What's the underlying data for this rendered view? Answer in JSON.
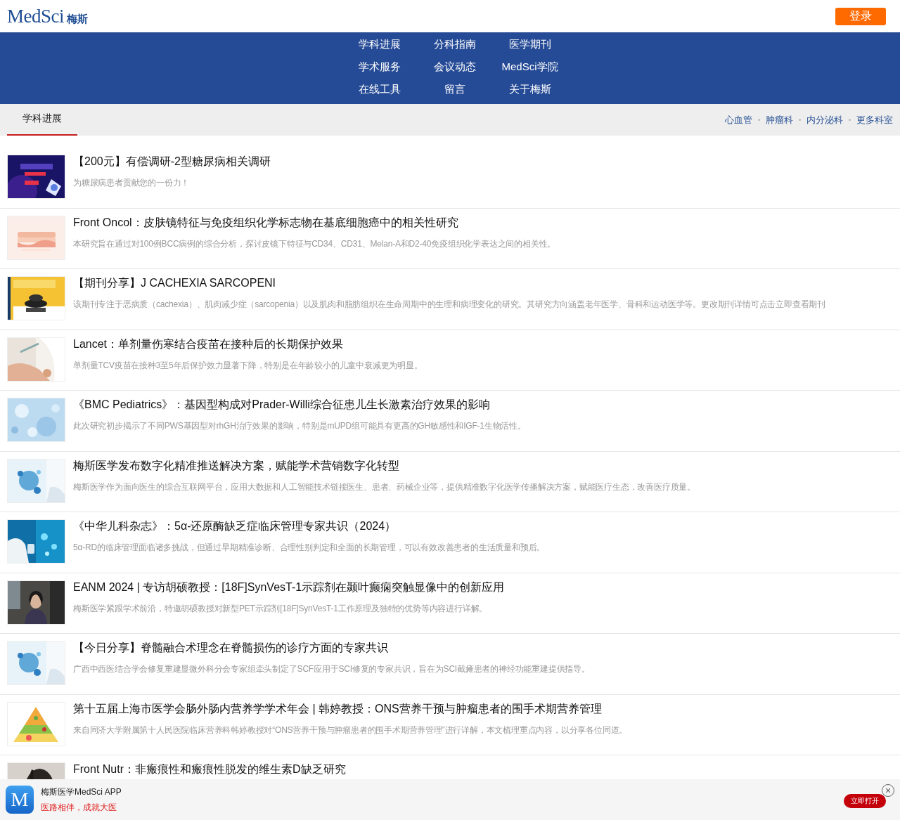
{
  "header": {
    "logo": "MedSci",
    "logo_suffix": "梅斯",
    "login_button": "登录"
  },
  "nav": {
    "items": [
      "学科进展",
      "分科指南",
      "医学期刊",
      "学术服务",
      "会议动态",
      "MedSci学院",
      "在线工具",
      "留言",
      "关于梅斯"
    ]
  },
  "tabs": [
    {
      "label": "学科进展",
      "selected": true
    }
  ],
  "departments": [
    "心血管",
    "肿瘤科",
    "内分泌科",
    "更多科室"
  ],
  "articles": [
    {
      "title": "【200元】有偿调研-2型糖尿病相关调研",
      "summary": "为糖尿病患者贡献您的一份力！"
    },
    {
      "title": "Front Oncol：皮肤镜特征与免疫组织化学标志物在基底细胞癌中的相关性研究",
      "summary": "本研究旨在通过对100例BCC病例的综合分析，探讨皮镜下特征与CD34、CD31、Melan-A和D2-40免疫组织化学表达之间的相关性。"
    },
    {
      "title": "【期刊分享】J CACHEXIA SARCOPENI",
      "summary": "该期刊专注于恶病质（cachexia）、肌肉减少症（sarcopenia）以及肌肉和脂肪组织在生命周期中的生理和病理变化的研究。其研究方向涵盖老年医学、骨科和运动医学等。更改期刊详情可点击立即查看期刊"
    },
    {
      "title": "Lancet：单剂量伤寒结合疫苗在接种后的长期保护效果",
      "summary": "单剂量TCV疫苗在接种3至5年后保护效力显著下降，特别是在年龄较小的儿童中衰减更为明显。"
    },
    {
      "title": "《BMC Pediatrics》：基因型构成对Prader-Willi综合征患儿生长激素治疗效果的影响",
      "summary": "此次研究初步揭示了不同PWS基因型对rhGH治疗效果的影响，特别是mUPD组可能具有更高的GH敏感性和IGF-1生物活性。"
    },
    {
      "title": "梅斯医学发布数字化精准推送解决方案，赋能学术营销数字化转型",
      "summary": "梅斯医学作为面向医生的综合互联网平台，应用大数据和人工智能技术链接医生、患者、药械企业等，提供精准数字化医学传播解决方案，赋能医疗生态，改善医疗质量。"
    },
    {
      "title": "《中华儿科杂志》：5α-还原酶缺乏症临床管理专家共识（2024）",
      "summary": "5α-RD的临床管理面临诸多挑战，但通过早期精准诊断、合理性别判定和全面的长期管理，可以有效改善患者的生活质量和预后。"
    },
    {
      "title": "EANM 2024 | 专访胡硕教授：[18F]SynVesT-1示踪剂在颞叶癫痫突触显像中的创新应用",
      "summary": "梅斯医学紧跟学术前沿，特邀胡硕教授对新型PET示踪剂[18F]SynVesT-1工作原理及独特的优势等内容进行详解。"
    },
    {
      "title": "【今日分享】脊髓融合术理念在脊髓损伤的诊疗方面的专家共识",
      "summary": "广西中西医结合学会修复重建显微外科分会专家组牵头制定了SCF应用于SCI修复的专家共识，旨在为SCI截瘫患者的神经功能重建提供指导。"
    },
    {
      "title": "第十五届上海市医学会肠外肠内营养学学术年会 | 韩婷教授：ONS营养干预与肿瘤患者的围手术期营养管理",
      "summary": "来自同济大学附属第十人民医院临床营养科韩婷教授对“ONS营养干预与肿瘤患者的围手术期营养管理”进行详解，本文梳理重点内容，以分享各位同道。"
    },
    {
      "title": "Front Nutr：非瘢痕性和瘢痕性脱发的维生素D缺乏研究"
    }
  ],
  "app_banner": {
    "icon_letter": "M",
    "name": "梅斯医学MedSci APP",
    "slogan": "医路相伴，成就大医",
    "open_button": "立即打开",
    "close_button": "×"
  }
}
